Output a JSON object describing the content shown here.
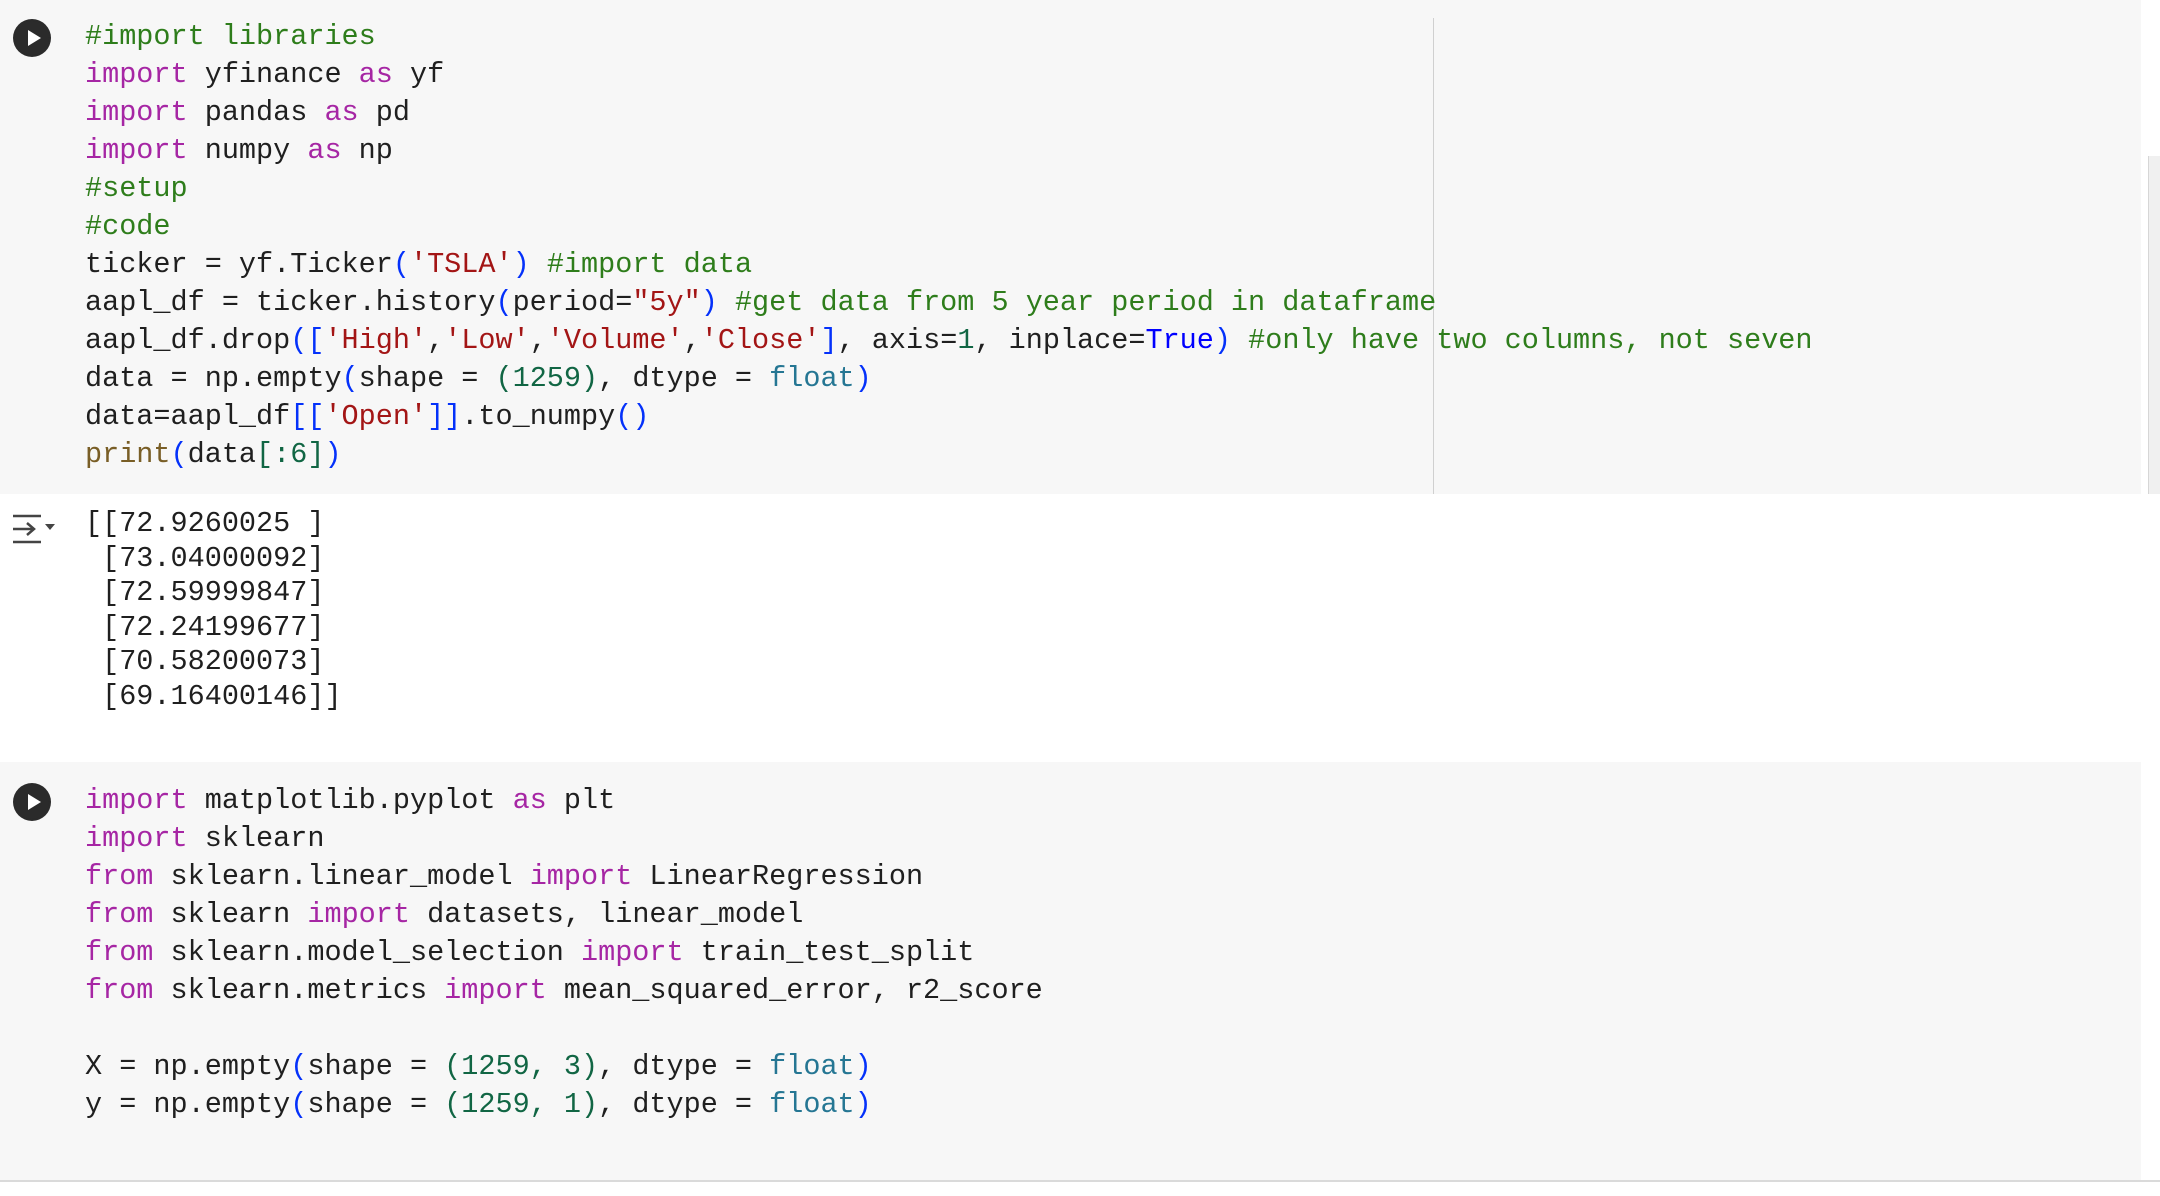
{
  "cell1": {
    "run_icon": "play-icon",
    "lines": [
      "#import libraries",
      "import yfinance as yf",
      "import pandas as pd",
      "import numpy as np",
      "#setup",
      "#code",
      "ticker = yf.Ticker('TSLA') #import data",
      "aapl_df = ticker.history(period=\"5y\") #get data from 5 year period in dataframe",
      "aapl_df.drop(['High','Low','Volume','Close'], axis=1, inplace=True) #only have two columns, not seven",
      "data = np.empty(shape = (1259), dtype = float)",
      "data=aapl_df[['Open']].to_numpy()",
      "print(data[:6])"
    ]
  },
  "output1": {
    "icon": "output-collapse-icon",
    "lines": [
      "[[72.9260025 ]",
      " [73.04000092]",
      " [72.59999847]",
      " [72.24199677]",
      " [70.58200073]",
      " [69.16400146]]"
    ]
  },
  "cell2": {
    "run_icon": "play-icon",
    "lines": [
      "import matplotlib.pyplot as plt",
      "import sklearn",
      "from sklearn.linear_model import LinearRegression",
      "from sklearn import datasets, linear_model",
      "from sklearn.model_selection import train_test_split",
      "from sklearn.metrics import mean_squared_error, r2_score",
      "",
      "X = np.empty(shape = (1259, 3), dtype = float)",
      "y = np.empty(shape = (1259, 1), dtype = float)"
    ]
  },
  "colors": {
    "keyword": "#a626a4",
    "comment": "#2e7d1b",
    "string": "#a31515",
    "number": "#116644",
    "builtin": "#795e26",
    "type": "#257693",
    "bool": "#0000ff",
    "bracket": "#0431fa",
    "cell_background": "#f7f7f7"
  }
}
